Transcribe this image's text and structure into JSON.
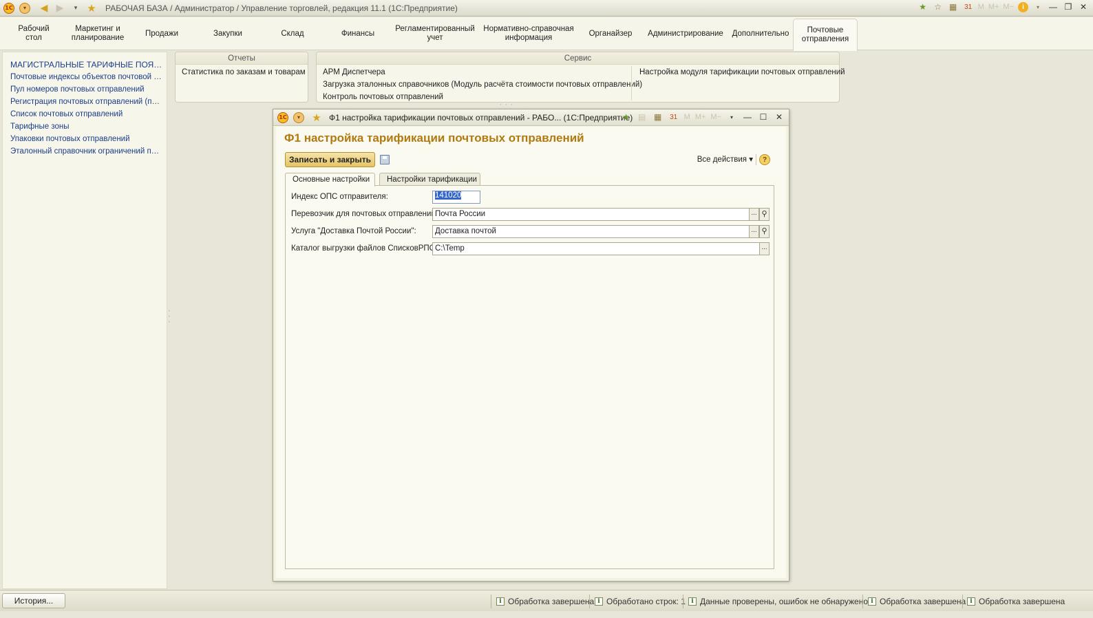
{
  "window": {
    "title": "РАБОЧАЯ БАЗА / Администратор / Управление торговлей, редакция 11.1  (1С:Предприятие)"
  },
  "sections": [
    {
      "label": "Рабочий\nстол"
    },
    {
      "label": "Маркетинг и\nпланирование"
    },
    {
      "label": "Продажи"
    },
    {
      "label": "Закупки"
    },
    {
      "label": "Склад"
    },
    {
      "label": "Финансы"
    },
    {
      "label": "Регламентированный\nучет"
    },
    {
      "label": "Нормативно-справочная\nинформация"
    },
    {
      "label": "Органайзер"
    },
    {
      "label": "Администрирование"
    },
    {
      "label": "Дополнительно"
    },
    {
      "label": "Почтовые\nотправления"
    }
  ],
  "nav": {
    "items": [
      "МАГИСТРАЛЬНЫЕ ТАРИФНЫЕ ПОЯСА...",
      "Почтовые индексы объектов почтовой с...",
      "Пул номеров почтовых отправлений",
      "Регистрация почтовых отправлений (под...",
      "Список почтовых отправлений",
      "Тарифные зоны",
      "Упаковки почтовых отправлений",
      "Эталонный справочник ограничений по п..."
    ]
  },
  "reports": {
    "title": "Отчеты",
    "items": [
      "Статистика по заказам и товарам"
    ]
  },
  "service": {
    "title": "Сервис",
    "col1": [
      "АРМ Диспетчера",
      "Загрузка эталонных справочников (Модуль расчёта стоимости почтовых отправлений)",
      "Контроль почтовых отправлений"
    ],
    "col2": [
      "Настройка модуля тарификации почтовых отправлений"
    ]
  },
  "dialog": {
    "title": "Ф1 настройка тарификации почтовых отправлений - РАБО...  (1С:Предприятие)",
    "form_title": "Ф1 настройка тарификации почтовых отправлений",
    "save_close": "Записать и закрыть",
    "all_actions": "Все действия ▾",
    "help": "?",
    "tabs": [
      "Основные настройки",
      "Настройки тарификации"
    ],
    "fields": {
      "sender_index_label": "Индекс ОПС отправителя:",
      "sender_index_value": "141020",
      "carrier_label": "Перевозчик для почтовых отправлений:",
      "carrier_value": "Почта России",
      "service_label": "Услуга \"Доставка Почтой России\":",
      "service_value": "Доставка почтой",
      "catalog_label": "Каталог выгрузки файлов СписковРПО:",
      "catalog_value": "C:\\Temp"
    }
  },
  "statusbar": {
    "history": "История...",
    "messages": [
      "Обработка завершена",
      "Обработано строк: 1",
      "Данные проверены, ошибок не обнаружено...",
      "Обработка завершена",
      "Обработка завершена"
    ]
  },
  "icons": {
    "logo": "1c-logo-icon",
    "menu": "menu-dropdown-icon",
    "back": "back-arrow-icon",
    "forward": "forward-arrow-icon",
    "favorites": "star-icon",
    "calculator": "calculator-icon",
    "calendar": "calendar-icon",
    "info": "info-icon"
  },
  "colors": {
    "accent_title": "#b07a10",
    "link": "#1a3c8a",
    "button_gold": "#e6c462",
    "selection": "#3366cc"
  }
}
